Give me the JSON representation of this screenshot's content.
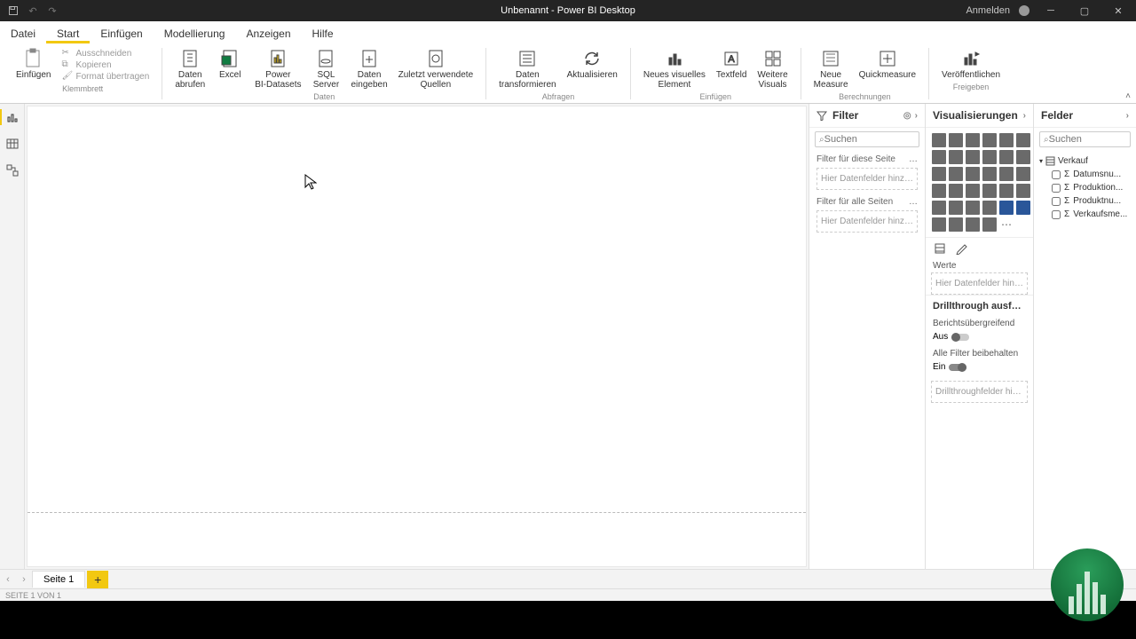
{
  "titlebar": {
    "title": "Unbenannt - Power BI Desktop",
    "signin": "Anmelden"
  },
  "menu": {
    "items": [
      "Datei",
      "Start",
      "Einfügen",
      "Modellierung",
      "Anzeigen",
      "Hilfe"
    ],
    "active": 1
  },
  "ribbon": {
    "clipboard": {
      "paste": "Einfügen",
      "cut": "Ausschneiden",
      "copy": "Kopieren",
      "format": "Format übertragen",
      "group": "Klemmbrett"
    },
    "data": {
      "getdata": "Daten\nabrufen",
      "excel": "Excel",
      "pbidatasets": "Power\nBI-Datasets",
      "sql": "SQL\nServer",
      "enter": "Daten\neingeben",
      "recent": "Zuletzt verwendete\nQuellen",
      "group": "Daten"
    },
    "queries": {
      "transform": "Daten\ntransformieren",
      "refresh": "Aktualisieren",
      "group": "Abfragen"
    },
    "insert": {
      "visual": "Neues visuelles\nElement",
      "textbox": "Textfeld",
      "more": "Weitere\nVisuals",
      "group": "Einfügen"
    },
    "calc": {
      "measure": "Neue\nMeasure",
      "quick": "Quickmeasure",
      "group": "Berechnungen"
    },
    "share": {
      "publish": "Veröffentlichen",
      "group": "Freigeben"
    }
  },
  "filter": {
    "title": "Filter",
    "search": "Suchen",
    "page_label": "Filter für diese Seite",
    "page_drop": "Hier Datenfelder hinzufüg...",
    "all_label": "Filter für alle Seiten",
    "all_drop": "Hier Datenfelder hinzufüg..."
  },
  "viz": {
    "title": "Visualisierungen",
    "werte": "Werte",
    "werte_drop": "Hier Datenfelder hinzufügen",
    "drill_title": "Drillthrough ausfü…",
    "cross": "Berichtsübergreifend",
    "cross_state": "Aus",
    "keep": "Alle Filter beibehalten",
    "keep_state": "Ein",
    "drill_drop": "Drillthroughfelder hier hinz..."
  },
  "fields": {
    "title": "Felder",
    "search": "Suchen",
    "table": "Verkauf",
    "cols": [
      "Datumsnu...",
      "Produktion...",
      "Produktnu...",
      "Verkaufsme..."
    ]
  },
  "pages": {
    "tab": "Seite 1",
    "status": "SEITE 1 VON 1"
  }
}
